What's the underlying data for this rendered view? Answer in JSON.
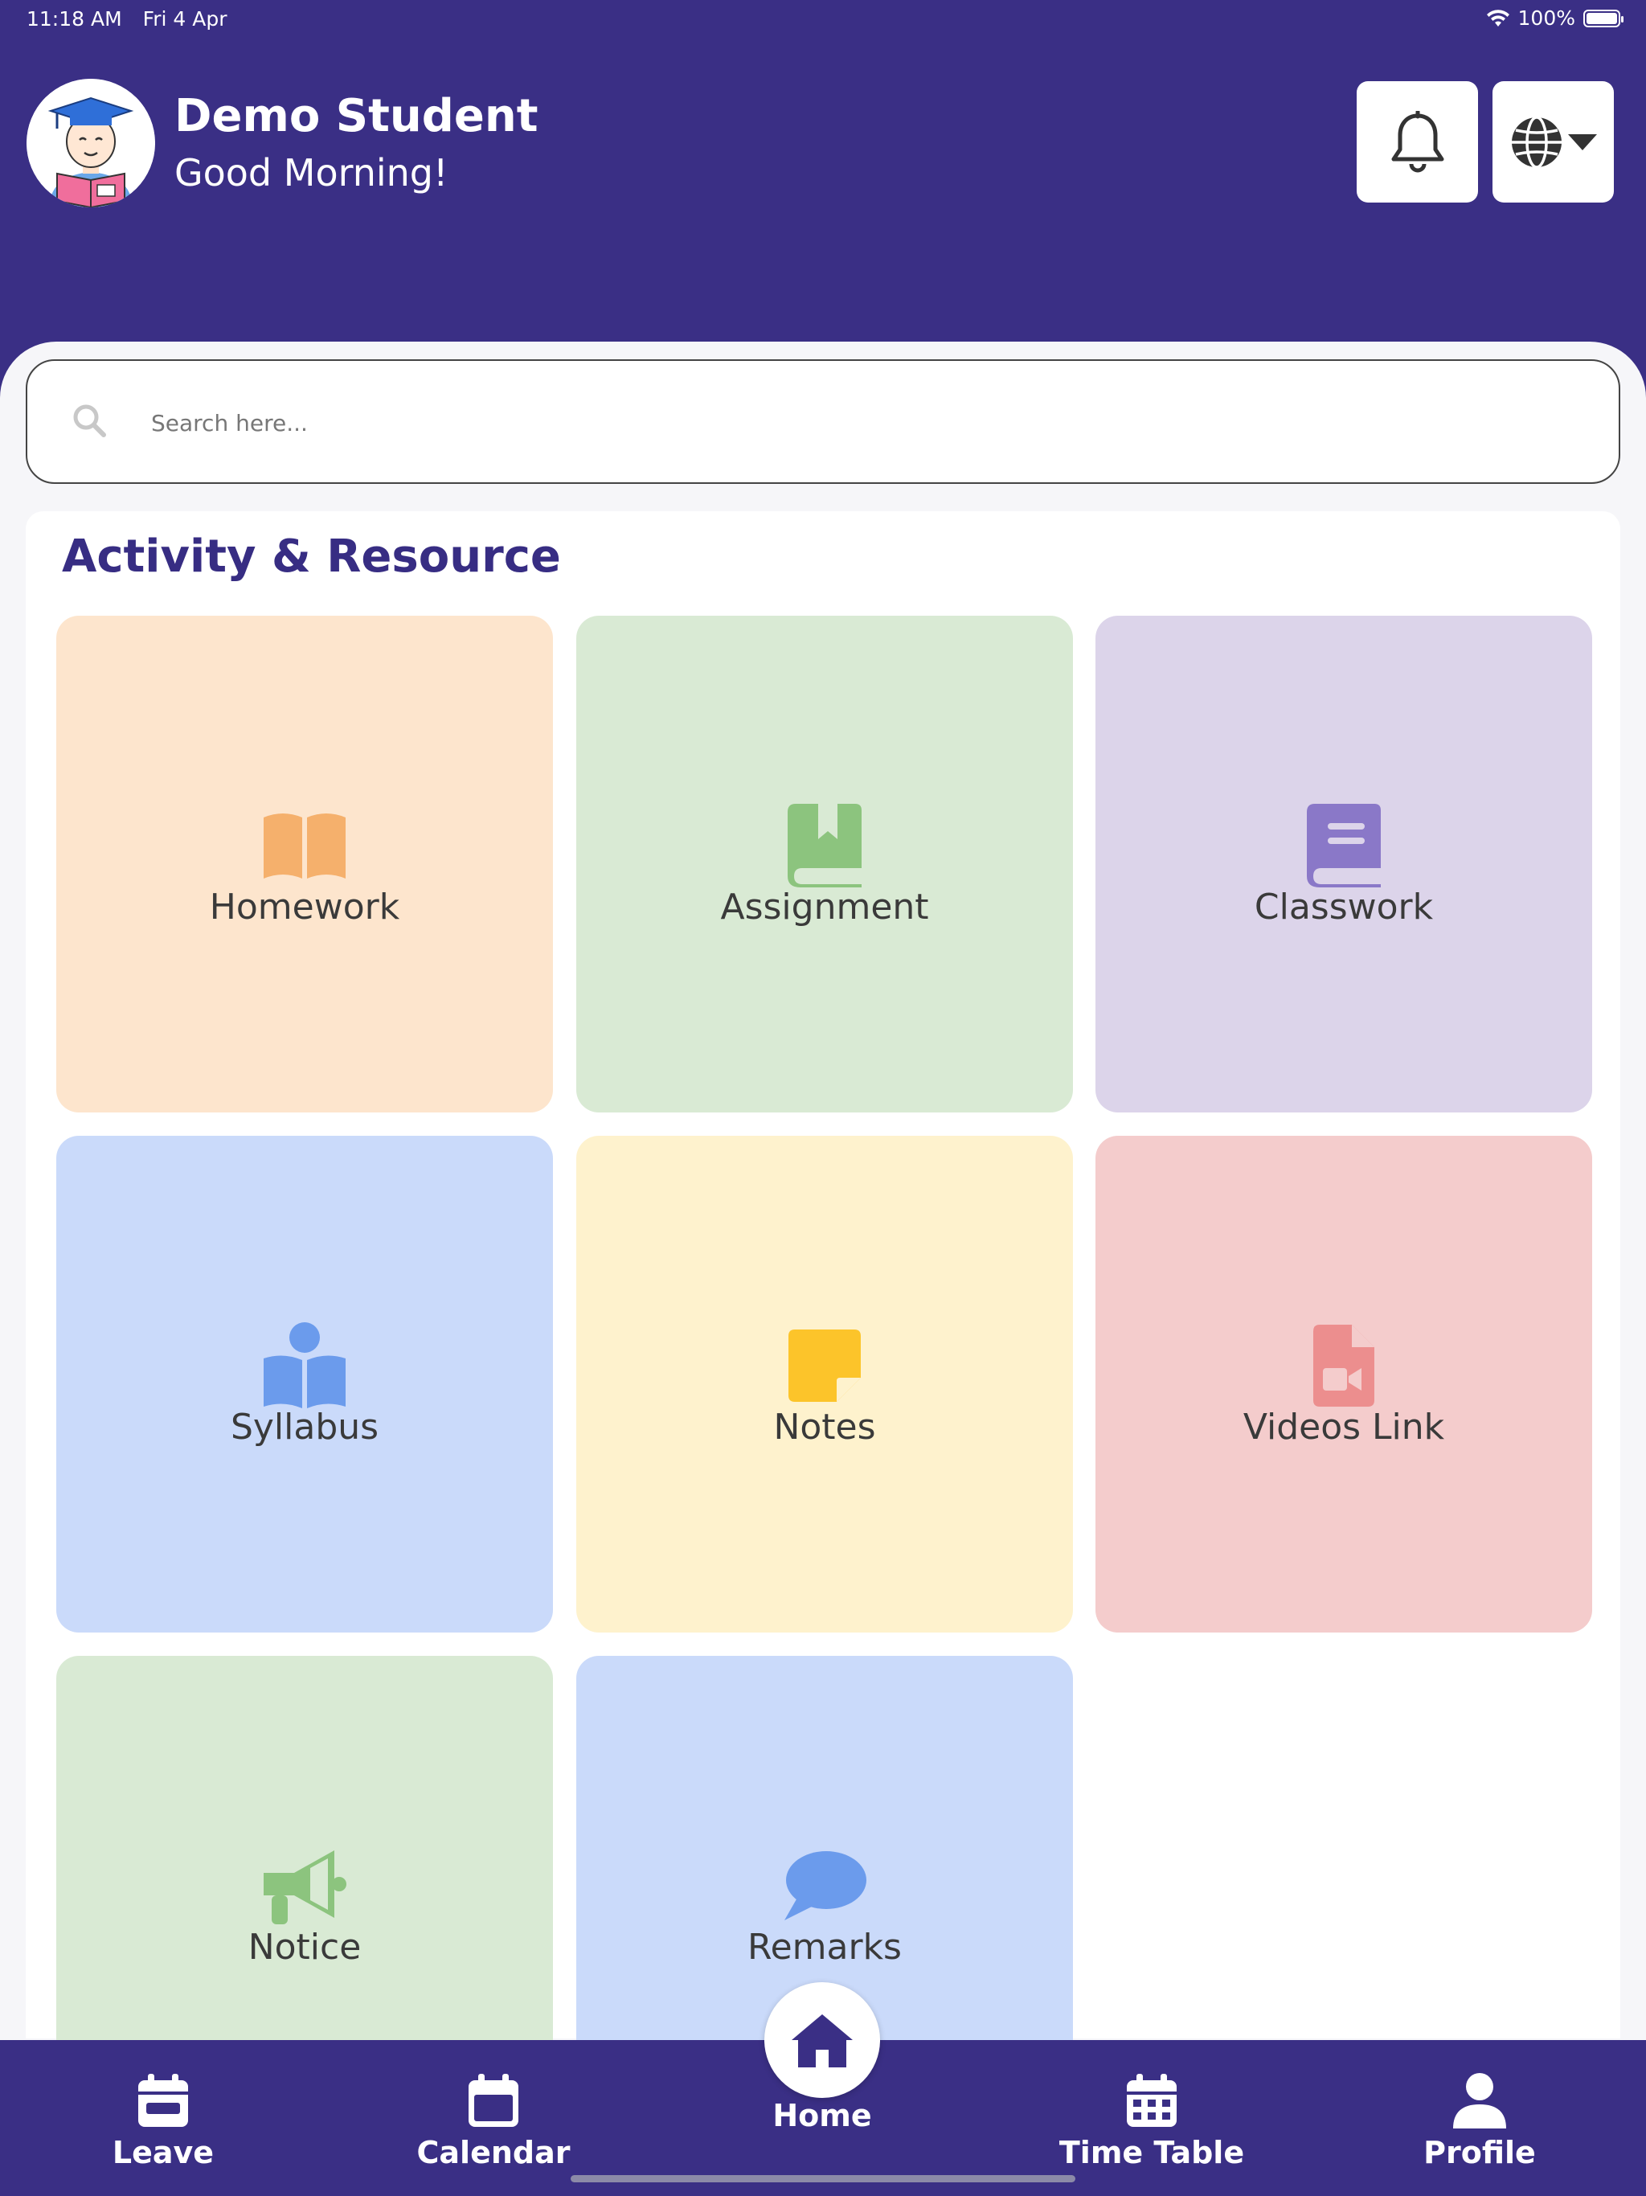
{
  "status_bar": {
    "time": "11:18 AM",
    "date": "Fri 4 Apr",
    "battery": "100%",
    "battery_level_percent": 100
  },
  "header": {
    "user_name": "Demo Student",
    "greeting": "Good Morning!",
    "avatar_icon": "student-avatar-icon",
    "bell_icon": "bell-icon",
    "language_icon": "globe-icon"
  },
  "search": {
    "placeholder": "Search here...",
    "value": ""
  },
  "section": {
    "title": "Activity & Resource"
  },
  "tiles": [
    {
      "label": "Homework",
      "icon": "open-book-icon",
      "bg": "#fde5cd",
      "accent": "#f5b06c"
    },
    {
      "label": "Assignment",
      "icon": "bookmark-book-icon",
      "bg": "#d9ead4",
      "accent": "#8cc47e"
    },
    {
      "label": "Classwork",
      "icon": "closed-book-icon",
      "bg": "#dcd4ea",
      "accent": "#8a78c8"
    },
    {
      "label": "Syllabus",
      "icon": "reader-icon",
      "bg": "#cadafa",
      "accent": "#6b9bec"
    },
    {
      "label": "Notes",
      "icon": "sticky-note-icon",
      "bg": "#fef2cd",
      "accent": "#fcc42a"
    },
    {
      "label": "Videos Link",
      "icon": "video-file-icon",
      "bg": "#f4cccc",
      "accent": "#ec8e8e"
    },
    {
      "label": "Notice",
      "icon": "megaphone-icon",
      "bg": "#d9ead4",
      "accent": "#8cc47e"
    },
    {
      "label": "Remarks",
      "icon": "speech-bubble-icon",
      "bg": "#cadafa",
      "accent": "#6b9bec"
    }
  ],
  "nav": {
    "leave": "Leave",
    "calendar": "Calendar",
    "home": "Home",
    "timetable": "Time Table",
    "profile": "Profile"
  },
  "colors": {
    "primary": "#3a2f85",
    "title": "#372d83"
  }
}
